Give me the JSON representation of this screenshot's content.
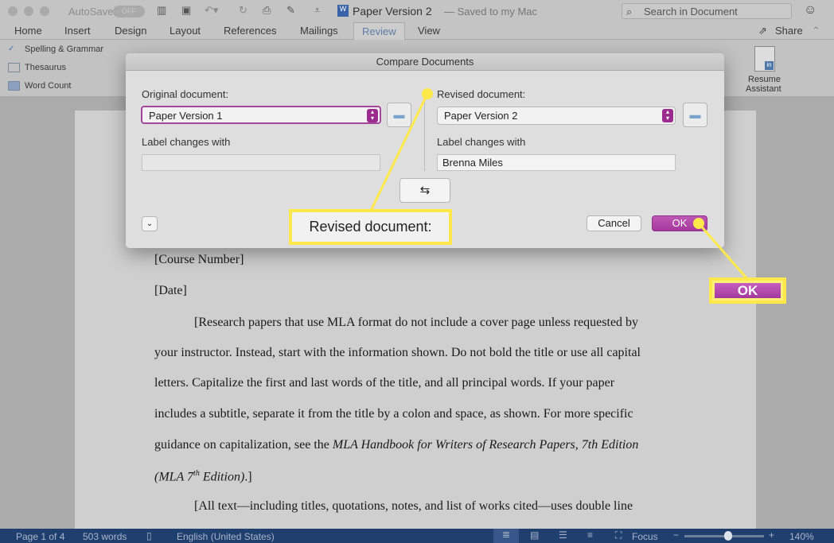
{
  "titlebar": {
    "autosave": "AutoSave",
    "autosave_state": "OFF",
    "doc_title": "Paper Version 2",
    "saved_status": "— Saved to my Mac",
    "search_placeholder": "Search in Document"
  },
  "tabs": [
    "Home",
    "Insert",
    "Design",
    "Layout",
    "References",
    "Mailings",
    "Review",
    "View"
  ],
  "active_tab": "Review",
  "share": "Share",
  "ribbon": {
    "spelling": "Spelling & Grammar",
    "thesaurus": "Thesaurus",
    "word_count": "Word Count",
    "resume_line1": "Resume",
    "resume_line2": "Assistant"
  },
  "dialog": {
    "title": "Compare Documents",
    "original_label": "Original document:",
    "original_value": "Paper Version 1",
    "revised_label": "Revised document:",
    "revised_value": "Paper Version 2",
    "label_changes_left": "Label changes with",
    "label_changes_left_value": "",
    "label_changes_right": "Label changes with",
    "label_changes_right_value": "Brenna Miles",
    "cancel": "Cancel",
    "ok": "OK"
  },
  "callouts": {
    "revised": "Revised document:",
    "ok": "OK",
    "color": "#ffe94a"
  },
  "document": {
    "lines": [
      "[Course Number]",
      "[Date]"
    ],
    "p1": [
      "[Research papers that use MLA format do not include a cover page unless requested by",
      "your instructor. Instead, start with the information shown. Do not bold the title or use all capital",
      "letters. Capitalize the first and last words of the title, and all principal words. If your paper",
      "includes a subtitle, separate it from the title by a colon and space, as shown. For more specific"
    ],
    "p1_l5a": "guidance on capitalization, see the ",
    "p1_l5b": "MLA Handbook for Writers of Research Papers, 7th Edition",
    "p1_l6a": "(MLA 7",
    "p1_l6sup": "th",
    "p1_l6b": " Edition)",
    ".": ".]",
    "p1_l6c": ".]",
    "p2": "[All text—including titles, quotations, notes, and list of works cited—uses double line"
  },
  "status": {
    "page": "Page 1 of 4",
    "words": "503 words",
    "language": "English (United States)",
    "focus": "Focus",
    "zoom": "140%",
    "zoom_level": 0.6
  }
}
